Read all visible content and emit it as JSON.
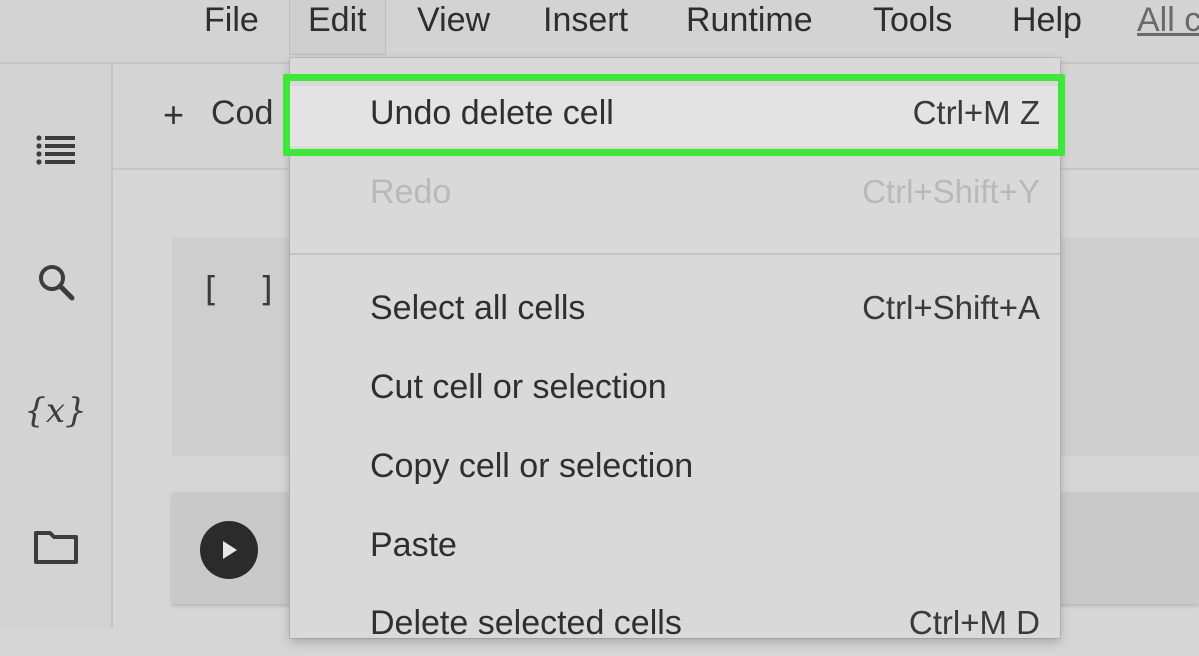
{
  "menubar": {
    "items": [
      {
        "label": "File"
      },
      {
        "label": "Edit"
      },
      {
        "label": "View"
      },
      {
        "label": "Insert"
      },
      {
        "label": "Runtime"
      },
      {
        "label": "Tools"
      },
      {
        "label": "Help"
      },
      {
        "label": "All c"
      }
    ]
  },
  "toolbar": {
    "add_code_label": "Cod"
  },
  "cell": {
    "execution_count": "[ ]"
  },
  "rail": {
    "icons": [
      "toc-icon",
      "search-icon",
      "variables-icon",
      "folder-icon"
    ],
    "variables_glyph": "{x}"
  },
  "edit_menu": {
    "items": [
      {
        "label": "Undo delete cell",
        "shortcut": "Ctrl+M Z",
        "state": "highlighted"
      },
      {
        "label": "Redo",
        "shortcut": "Ctrl+Shift+Y",
        "state": "disabled"
      },
      {
        "label": "Select all cells",
        "shortcut": "Ctrl+Shift+A",
        "state": "enabled"
      },
      {
        "label": "Cut cell or selection",
        "shortcut": "",
        "state": "enabled"
      },
      {
        "label": "Copy cell or selection",
        "shortcut": "",
        "state": "enabled"
      },
      {
        "label": "Paste",
        "shortcut": "",
        "state": "enabled"
      },
      {
        "label": "Delete selected cells",
        "shortcut": "Ctrl+M D",
        "state": "enabled"
      }
    ]
  },
  "colors": {
    "highlight_border": "#3ee83a",
    "background": "#d6d6d6",
    "disabled_text": "#b9b9b9"
  }
}
